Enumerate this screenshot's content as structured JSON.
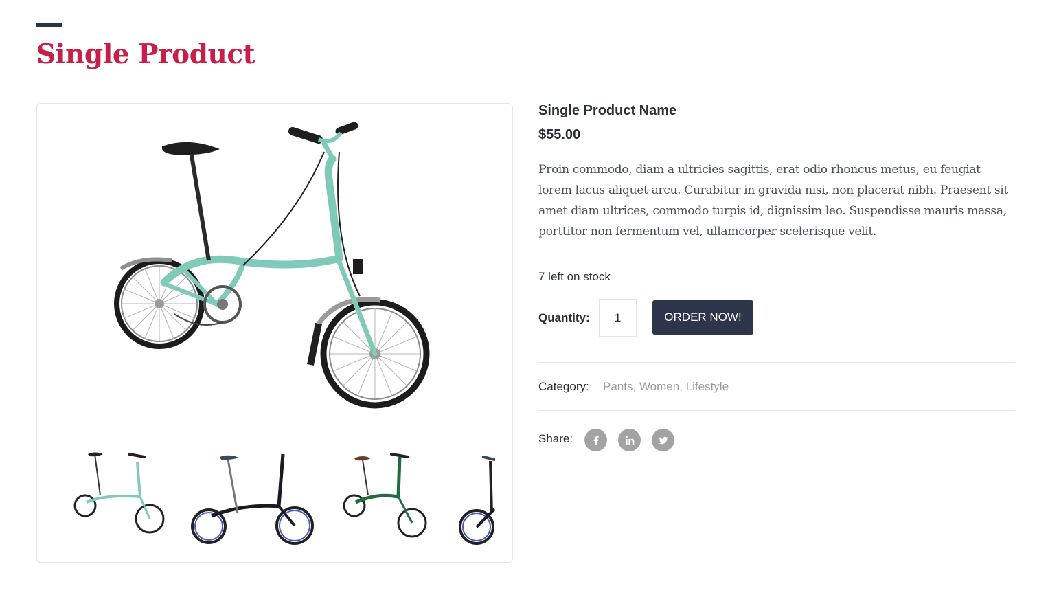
{
  "page": {
    "title": "Single Product"
  },
  "product": {
    "name": "Single Product Name",
    "price": "$55.00",
    "description": "Proin commodo, diam a ultricies sagittis, erat odio rhoncus metus, eu feugiat lorem lacus aliquet arcu. Curabitur in gravida nisi, non placerat nibh. Praesent sit amet diam ultrices, commodo turpis id, dignissim leo. Suspendisse mauris massa, porttitor non fermentum vel, ullamcorper scelerisque velit.",
    "stock": "7 left on stock"
  },
  "order": {
    "quantity_label": "Quantity:",
    "quantity_value": "1",
    "button_label": "ORDER NOW!"
  },
  "category": {
    "label": "Category:",
    "items": [
      "Pants",
      "Women",
      "Lifestyle"
    ]
  },
  "share": {
    "label": "Share:",
    "icons": [
      "facebook-icon",
      "linkedin-icon",
      "twitter-icon"
    ]
  },
  "gallery": {
    "main_image": "teal-folding-bike",
    "thumbnails": [
      "teal-folding-bike",
      "black-folding-bike",
      "green-folding-bike",
      "black-folding-bike"
    ]
  },
  "colors": {
    "title": "#c6204a",
    "button": "#2c3549",
    "accent_bar": "#2b3446",
    "social_icon": "#a3a3a3",
    "category_link": "#9a9a9a"
  }
}
